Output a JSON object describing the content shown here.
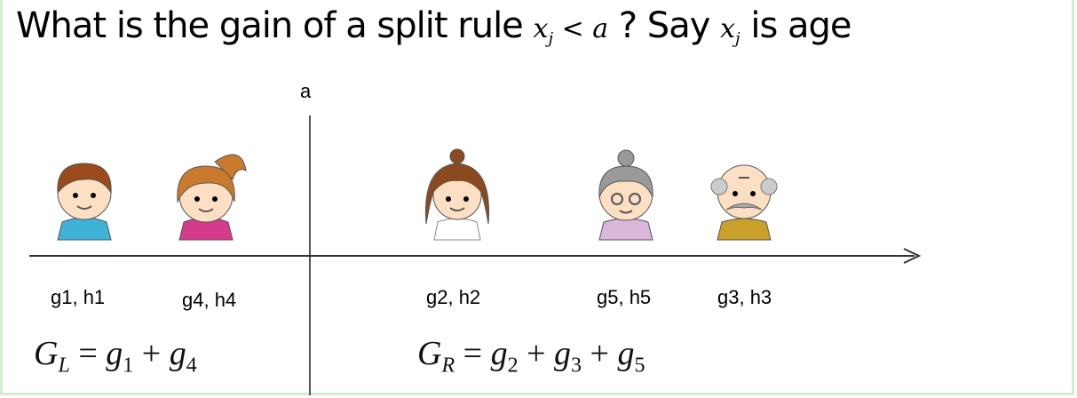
{
  "title": {
    "prefix": "What is the gain of a split rule ",
    "math_var": "x",
    "math_sub": "j",
    "math_rest": " < a",
    "middle": " ? Say ",
    "math_var2": "x",
    "math_sub2": "j",
    "suffix": " is age"
  },
  "split_label": "a",
  "people": [
    {
      "icon": "boy-icon",
      "label": "g1, h1"
    },
    {
      "icon": "girl-ponytail-icon",
      "label": "g4, h4"
    },
    {
      "icon": "young-woman-icon",
      "label": "g2, h2"
    },
    {
      "icon": "grandmother-icon",
      "label": "g5, h5"
    },
    {
      "icon": "grandfather-icon",
      "label": "g3, h3"
    }
  ],
  "formulas": {
    "left": {
      "lhs": "G",
      "lhs_sub": "L",
      "eq": " = ",
      "terms": [
        "g",
        "1",
        " + ",
        "g",
        "4"
      ]
    },
    "right": {
      "lhs": "G",
      "lhs_sub": "R",
      "eq": " = ",
      "terms": [
        "g",
        "2",
        " + ",
        "g",
        "3",
        " + ",
        "g",
        "5"
      ]
    }
  },
  "colors": {
    "border": "#d5ecd0",
    "axis": "#333333"
  }
}
